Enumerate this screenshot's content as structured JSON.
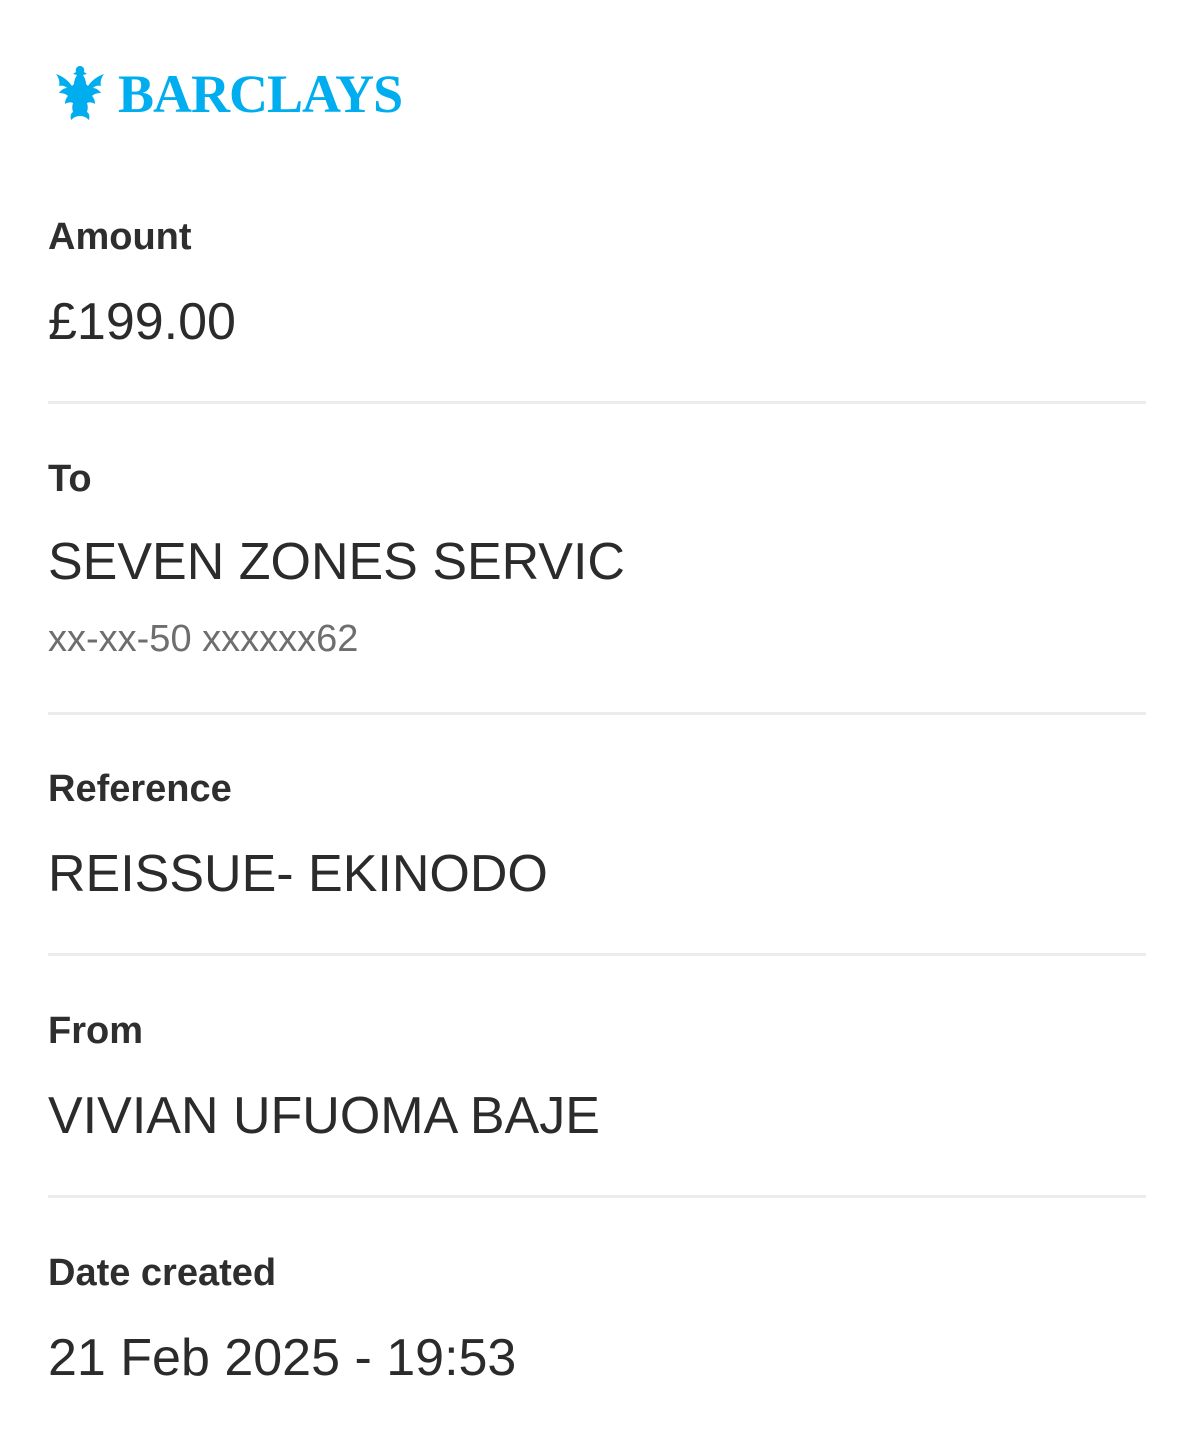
{
  "brand": {
    "name": "BARCLAYS",
    "icon": "eagle-icon",
    "color": "#00aeef"
  },
  "payment": {
    "amount": {
      "label": "Amount",
      "value": "£199.00"
    },
    "to": {
      "label": "To",
      "name": "SEVEN ZONES SERVIC",
      "account": "xx-xx-50 xxxxxx62"
    },
    "reference": {
      "label": "Reference",
      "value": "REISSUE- EKINODO"
    },
    "from": {
      "label": "From",
      "value": "VIVIAN UFUOMA BAJE"
    },
    "date_created": {
      "label": "Date created",
      "value": "21 Feb 2025 - 19:53"
    }
  }
}
